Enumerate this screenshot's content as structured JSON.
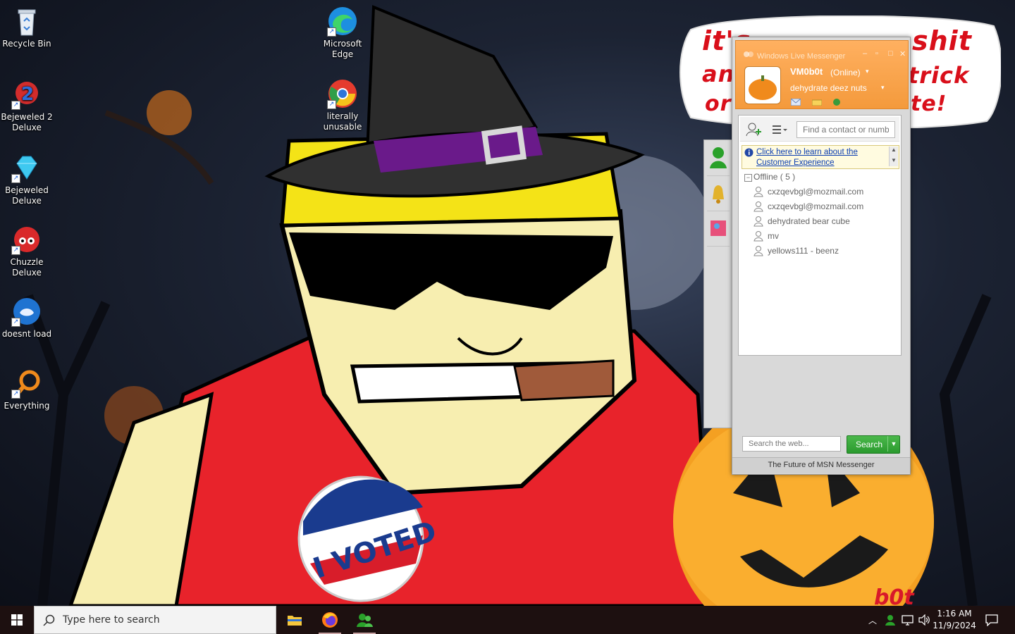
{
  "desktop": {
    "icons": [
      {
        "label": "Recycle Bin"
      },
      {
        "label": "Bejeweled 2 Deluxe"
      },
      {
        "label": "Bejeweled Deluxe"
      },
      {
        "label": "Chuzzle Deluxe"
      },
      {
        "label": "doesnt load"
      },
      {
        "label": "Everything"
      },
      {
        "label": "Microsoft Edge"
      },
      {
        "label": "literally unusable"
      }
    ],
    "bubble": {
      "words": [
        "it's",
        "shit",
        "an",
        "trick",
        "or",
        "te!"
      ]
    },
    "badge_text": "I VOTED",
    "signature": "b0t"
  },
  "messenger": {
    "title": "Windows Live Messenger",
    "username": "VM0b0t",
    "status": "(Online)",
    "personal_message": "dehydrate deez nuts",
    "find_placeholder": "Find a contact or number",
    "info_link": "Click here to learn about the Customer Experience",
    "group": "Offline ( 5 )",
    "contacts": [
      "cxzqevbgl@mozmail.com",
      "cxzqevbgl@mozmail.com",
      "dehydrated bear cube",
      "mv",
      "yellows111 - beenz"
    ],
    "web_search_placeholder": "Search the web...",
    "search_label": "Search",
    "footer": "The Future of MSN Messenger"
  },
  "taskbar": {
    "search_placeholder": "Type here to search",
    "time": "1:16 AM",
    "date": "11/9/2024"
  },
  "colors": {
    "messenger_orange": "#f49a3c",
    "taskbar": "#1d1010",
    "search_green": "#2a9a2e",
    "bubble_red": "#d90f1a"
  }
}
